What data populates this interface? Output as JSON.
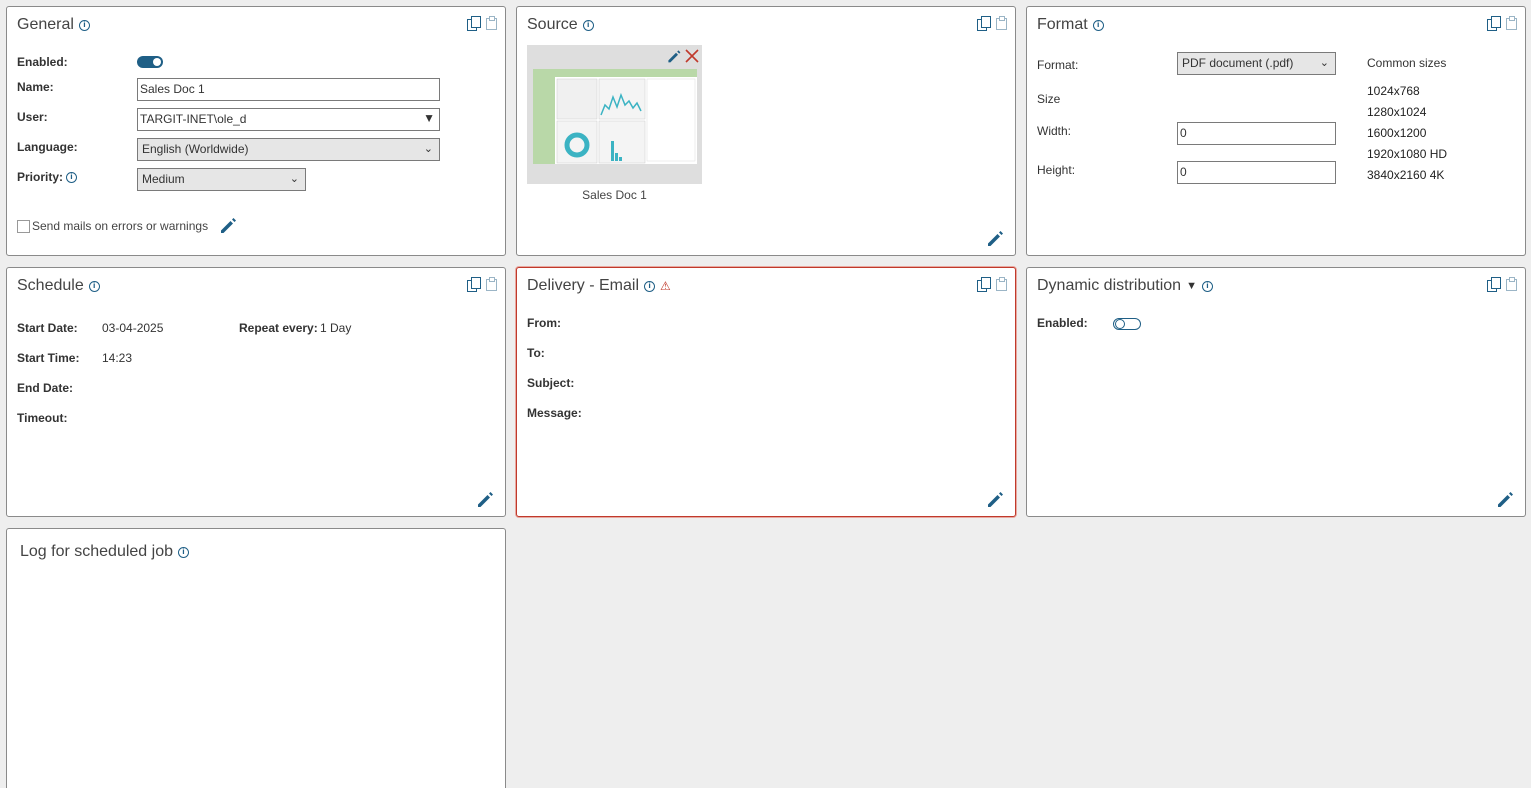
{
  "general": {
    "title": "General",
    "enabled_label": "Enabled:",
    "enabled": true,
    "name_label": "Name:",
    "name_value": "Sales Doc 1",
    "user_label": "User:",
    "user_value": "TARGIT-INET\\ole_d",
    "language_label": "Language:",
    "language_value": "English (Worldwide)",
    "priority_label": "Priority:",
    "priority_value": "Medium",
    "send_mails_label": "Send mails on errors or warnings",
    "send_mails_checked": false
  },
  "source": {
    "title": "Source",
    "document_name": "Sales Doc 1"
  },
  "format": {
    "title": "Format",
    "format_label": "Format:",
    "format_value": "PDF document (.pdf)",
    "size_label": "Size",
    "width_label": "Width:",
    "width_value": "0",
    "height_label": "Height:",
    "height_value": "0",
    "common_sizes_label": "Common sizes",
    "common_sizes": [
      "1024x768",
      "1280x1024",
      "1600x1200",
      "1920x1080 HD",
      "3840x2160 4K"
    ]
  },
  "schedule": {
    "title": "Schedule",
    "start_date_label": "Start Date:",
    "start_date_value": "03-04-2025",
    "repeat_label": "Repeat every:",
    "repeat_value": "1 Day",
    "start_time_label": "Start Time:",
    "start_time_value": "14:23",
    "end_date_label": "End Date:",
    "timeout_label": "Timeout:"
  },
  "delivery": {
    "title": "Delivery - Email",
    "from_label": "From:",
    "to_label": "To:",
    "subject_label": "Subject:",
    "message_label": "Message:"
  },
  "dynamic": {
    "title": "Dynamic distribution",
    "enabled_label": "Enabled:",
    "enabled": false
  },
  "log": {
    "title": "Log for scheduled job"
  },
  "colors": {
    "accent": "#1f5f86",
    "warning": "#c0392b",
    "background": "#eeeeee"
  }
}
